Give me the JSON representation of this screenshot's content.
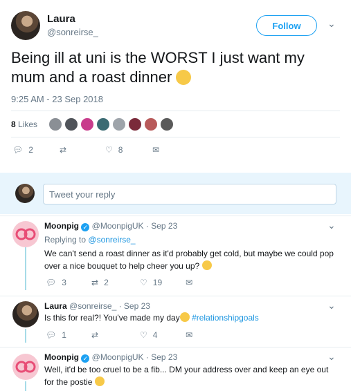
{
  "main_tweet": {
    "author_name": "Laura",
    "author_handle": "@sonreirse_",
    "follow_label": "Follow",
    "text": "Being ill at uni is the WORST I just want my mum and a roast dinner",
    "timestamp": "9:25 AM - 23 Sep 2018",
    "likes_count": "8",
    "likes_label": "Likes",
    "reply_count": "2",
    "like_count": "8"
  },
  "reply_box": {
    "placeholder": "Tweet your reply"
  },
  "replies": [
    {
      "author_name": "Moonpig",
      "author_handle": "@MoonpigUK",
      "date": "· Sep 23",
      "replying_to_prefix": "Replying to",
      "replying_to_handle": "@sonreirse_",
      "text": "We can't send a roast dinner as it'd probably get cold, but maybe we could pop over a nice bouquet to help cheer you up?",
      "reply_count": "3",
      "retweet_count": "2",
      "like_count": "19"
    },
    {
      "author_name": "Laura",
      "author_handle": "@sonreirse_",
      "date": "· Sep 23",
      "text": "Is this for real?! You've made my day",
      "hashtag": "#relationshipgoals",
      "reply_count": "1",
      "like_count": "4"
    },
    {
      "author_name": "Moonpig",
      "author_handle": "@MoonpigUK",
      "date": "· Sep 23",
      "text": "Well, it'd be too cruel to be a fib... DM your address over and keep an eye out for the postie"
    }
  ],
  "colors": {
    "accent": "#1da1f2",
    "link": "#1b95e0",
    "verified": "#1da1f2",
    "thread": "#a6dbe8",
    "moonpig_bg": "#f7c7d2",
    "moonpig_logo": "#e84d76"
  }
}
